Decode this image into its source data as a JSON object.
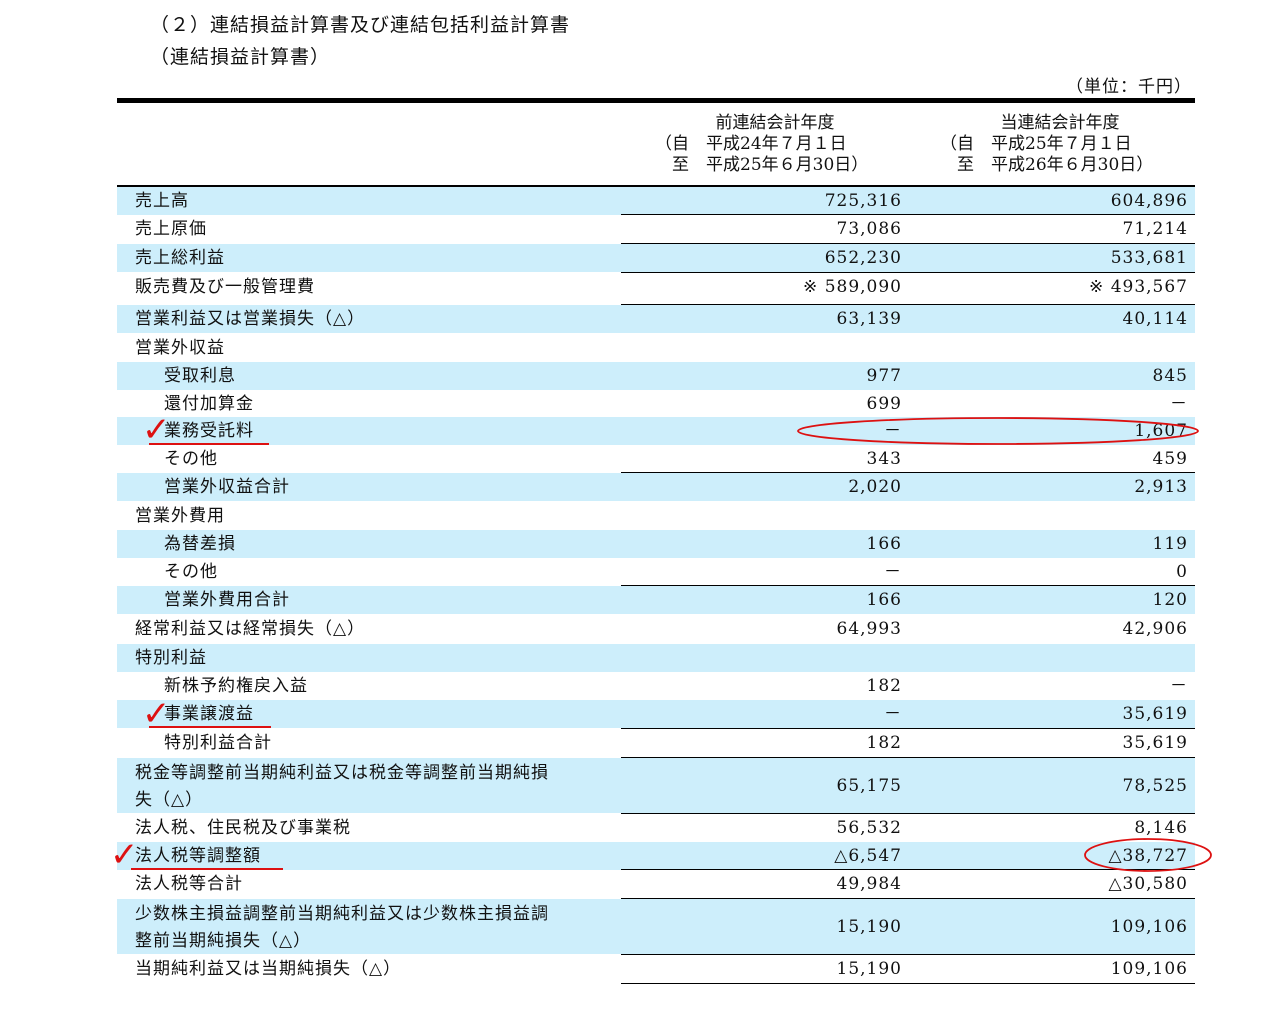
{
  "title": "（２）連結損益計算書及び連結包括利益計算書",
  "subtitle": "（連結損益計算書）",
  "unit": "（単位：千円）",
  "columns": {
    "prev": {
      "line1": "前連結会計年度",
      "line2": "（自　平成24年７月１日",
      "line3": "　至　平成25年６月30日）"
    },
    "curr": {
      "line1": "当連結会計年度",
      "line2": "（自　平成25年７月１日",
      "line3": "　至　平成26年６月30日）"
    }
  },
  "rows": [
    {
      "label": "売上高",
      "prev": "725,316",
      "curr": "604,896"
    },
    {
      "label": "売上原価",
      "prev": "73,086",
      "curr": "71,214"
    },
    {
      "label": "売上総利益",
      "prev": "652,230",
      "curr": "533,681"
    },
    {
      "label": "販売費及び一般管理費",
      "prev": "※ 589,090",
      "curr": "※ 493,567"
    },
    {
      "label": "営業利益又は営業損失（△）",
      "prev": "63,139",
      "curr": "40,114"
    },
    {
      "label": "営業外収益",
      "prev": "",
      "curr": ""
    },
    {
      "label": "受取利息",
      "prev": "977",
      "curr": "845"
    },
    {
      "label": "還付加算金",
      "prev": "699",
      "curr": "－"
    },
    {
      "label": "業務受託料",
      "prev": "－",
      "curr": "1,607"
    },
    {
      "label": "その他",
      "prev": "343",
      "curr": "459"
    },
    {
      "label": "営業外収益合計",
      "prev": "2,020",
      "curr": "2,913"
    },
    {
      "label": "営業外費用",
      "prev": "",
      "curr": ""
    },
    {
      "label": "為替差損",
      "prev": "166",
      "curr": "119"
    },
    {
      "label": "その他",
      "prev": "－",
      "curr": "0"
    },
    {
      "label": "営業外費用合計",
      "prev": "166",
      "curr": "120"
    },
    {
      "label": "経常利益又は経常損失（△）",
      "prev": "64,993",
      "curr": "42,906"
    },
    {
      "label": "特別利益",
      "prev": "",
      "curr": ""
    },
    {
      "label": "新株予約権戻入益",
      "prev": "182",
      "curr": "－"
    },
    {
      "label": "事業譲渡益",
      "prev": "－",
      "curr": "35,619"
    },
    {
      "label": "特別利益合計",
      "prev": "182",
      "curr": "35,619"
    },
    {
      "label": "税金等調整前当期純利益又は税金等調整前当期純損\n失（△）",
      "prev": "65,175",
      "curr": "78,525"
    },
    {
      "label": "法人税、住民税及び事業税",
      "prev": "56,532",
      "curr": "8,146"
    },
    {
      "label": "法人税等調整額",
      "prev": "△6,547",
      "curr": "△38,727"
    },
    {
      "label": "法人税等合計",
      "prev": "49,984",
      "curr": "△30,580"
    },
    {
      "label": "少数株主損益調整前当期純利益又は少数株主損益調\n整前当期純損失（△）",
      "prev": "15,190",
      "curr": "109,106"
    },
    {
      "label": "当期純利益又は当期純損失（△）",
      "prev": "15,190",
      "curr": "109,106"
    }
  ],
  "annotations": {
    "check_mark": "✓",
    "color": "#dd1111"
  }
}
